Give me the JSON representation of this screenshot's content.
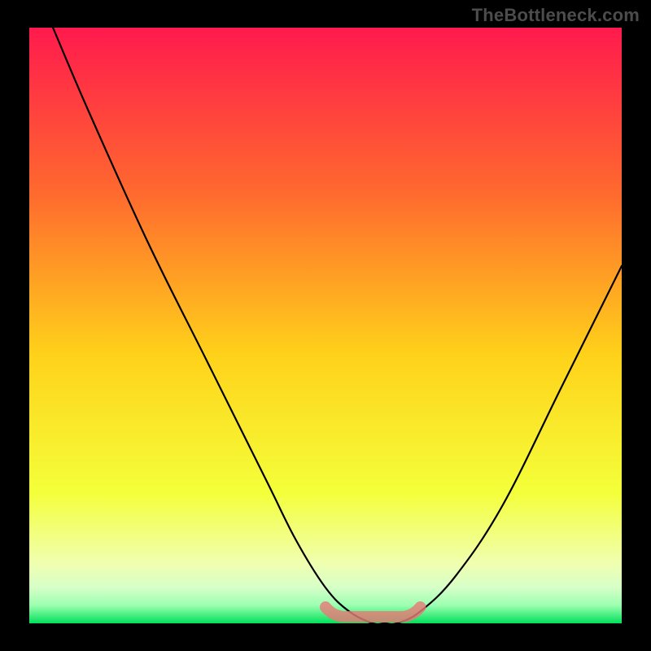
{
  "watermark": "TheBottleneck.com",
  "colors": {
    "frame": "#000000",
    "gradient_top": "#ff1a4d",
    "gradient_upper": "#ff6a2e",
    "gradient_mid": "#ffd21a",
    "gradient_low": "#f4ff3a",
    "gradient_strip1": "#f0ffb0",
    "gradient_strip2": "#d6ffc8",
    "gradient_strip3": "#9bffb0",
    "gradient_bottom": "#00e05a",
    "curve": "#000000",
    "bottom_highlight": "#e87a77"
  },
  "chart_data": {
    "type": "line",
    "title": "",
    "xlabel": "",
    "ylabel": "",
    "xlim": [
      0,
      100
    ],
    "ylim": [
      0,
      100
    ],
    "series": [
      {
        "name": "bottleneck-curve",
        "x": [
          4,
          10,
          20,
          30,
          40,
          45,
          50,
          54,
          58,
          60,
          62,
          66,
          72,
          80,
          90,
          100
        ],
        "values": [
          100,
          86,
          64,
          44,
          24,
          14,
          6,
          2,
          0,
          0,
          0,
          2,
          8,
          20,
          40,
          60
        ]
      }
    ],
    "highlight": {
      "name": "minimum-region",
      "x_range": [
        50,
        66
      ],
      "y": 0
    }
  }
}
